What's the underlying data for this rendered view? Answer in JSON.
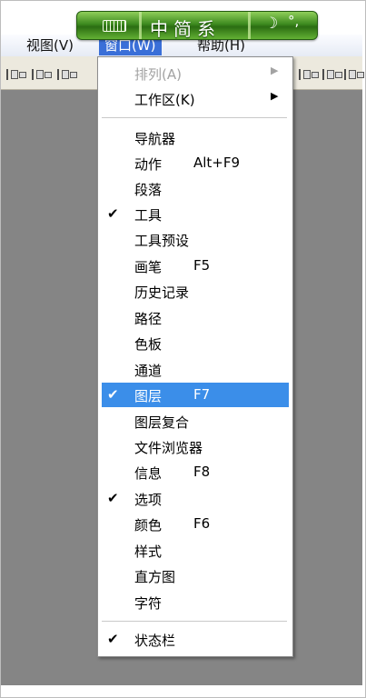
{
  "ime": {
    "title": "中简系",
    "keyboard_icon": "keyboard-icon",
    "moon_icon": "moon-icon",
    "punctuation_icon": "punctuation-icon",
    "accent": "#3d8a1f"
  },
  "menubar": {
    "items": [
      {
        "label": "视图(V)",
        "active": false
      },
      {
        "label": "窗口(W)",
        "active": true
      },
      {
        "label": "帮助(H)",
        "active": false
      }
    ],
    "accent": "#3a6fd8"
  },
  "menu": {
    "highlight_color": "#3b8ee9",
    "check_glyph": "✔",
    "arrow_glyph": "▶",
    "items": [
      {
        "label": "排列(A)",
        "disabled": true,
        "submenu": true
      },
      {
        "label": "工作区(K)",
        "submenu": true
      },
      {
        "label": "导航器"
      },
      {
        "label": "动作",
        "shortcut": "Alt+F9"
      },
      {
        "label": "段落"
      },
      {
        "label": "工具",
        "checked": true
      },
      {
        "label": "工具预设"
      },
      {
        "label": "画笔",
        "shortcut": "F5"
      },
      {
        "label": "历史记录"
      },
      {
        "label": "路径"
      },
      {
        "label": "色板"
      },
      {
        "label": "通道"
      },
      {
        "label": "图层",
        "shortcut": "F7",
        "checked": true,
        "highlighted": true
      },
      {
        "label": "图层复合"
      },
      {
        "label": "文件浏览器"
      },
      {
        "label": "信息",
        "shortcut": "F8"
      },
      {
        "label": "选项",
        "checked": true
      },
      {
        "label": "颜色",
        "shortcut": "F6"
      },
      {
        "label": "样式"
      },
      {
        "label": "直方图"
      },
      {
        "label": "字符"
      },
      {
        "label": "状态栏",
        "checked": true
      }
    ]
  }
}
